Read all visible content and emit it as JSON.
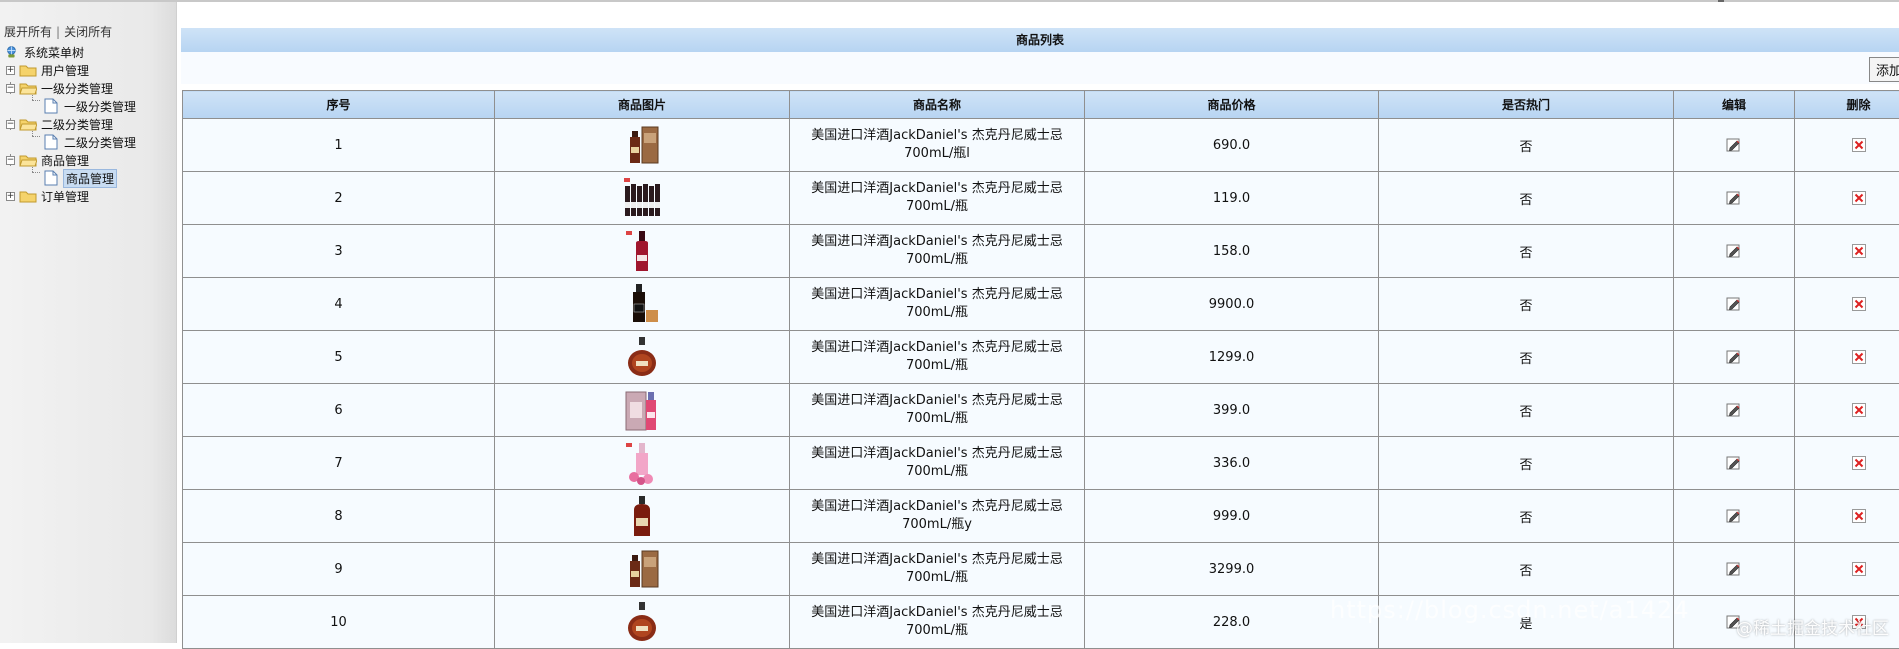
{
  "sidebar": {
    "expand_all": "展开所有",
    "separator": "|",
    "collapse_all": "关闭所有",
    "root_label": "系统菜单树",
    "groups": [
      {
        "label": "用户管理",
        "expanded": false,
        "child": ""
      },
      {
        "label": "一级分类管理",
        "expanded": true,
        "child": "一级分类管理"
      },
      {
        "label": "二级分类管理",
        "expanded": true,
        "child": "二级分类管理"
      },
      {
        "label": "商品管理",
        "expanded": true,
        "child": "商品管理"
      },
      {
        "label": "订单管理",
        "expanded": false,
        "child": ""
      }
    ]
  },
  "main": {
    "title": "商品列表",
    "add_button": "添加"
  },
  "table": {
    "headers": {
      "seq": "序号",
      "image": "商品图片",
      "name": "商品名称",
      "price": "商品价格",
      "hot": "是否热门",
      "edit": "编辑",
      "delete": "删除"
    },
    "rows": [
      {
        "seq": "1",
        "name": "美国进口洋酒JackDaniel's 杰克丹尼威士忌700mL/瓶l",
        "price": "690.0",
        "hot": "否",
        "thumb": "bottle-gift-box"
      },
      {
        "seq": "2",
        "name": "美国进口洋酒JackDaniel's 杰克丹尼威士忌700mL/瓶",
        "price": "119.0",
        "hot": "否",
        "thumb": "wine-six-pack"
      },
      {
        "seq": "3",
        "name": "美国进口洋酒JackDaniel's 杰克丹尼威士忌700mL/瓶",
        "price": "158.0",
        "hot": "否",
        "thumb": "red-wine-bottle"
      },
      {
        "seq": "4",
        "name": "美国进口洋酒JackDaniel's 杰克丹尼威士忌700mL/瓶",
        "price": "9900.0",
        "hot": "否",
        "thumb": "whisky-with-glass"
      },
      {
        "seq": "5",
        "name": "美国进口洋酒JackDaniel's 杰克丹尼威士忌700mL/瓶",
        "price": "1299.0",
        "hot": "否",
        "thumb": "cognac-decanter"
      },
      {
        "seq": "6",
        "name": "美国进口洋酒JackDaniel's 杰克丹尼威士忌700mL/瓶",
        "price": "399.0",
        "hot": "否",
        "thumb": "pink-gift-box"
      },
      {
        "seq": "7",
        "name": "美国进口洋酒JackDaniel's 杰克丹尼威士忌700mL/瓶",
        "price": "336.0",
        "hot": "否",
        "thumb": "pink-bottle-flowers"
      },
      {
        "seq": "8",
        "name": "美国进口洋酒JackDaniel's 杰克丹尼威士忌700mL/瓶y",
        "price": "999.0",
        "hot": "否",
        "thumb": "brandy-bottle"
      },
      {
        "seq": "9",
        "name": "美国进口洋酒JackDaniel's 杰克丹尼威士忌700mL/瓶",
        "price": "3299.0",
        "hot": "否",
        "thumb": "bottle-gift-box"
      },
      {
        "seq": "10",
        "name": "美国进口洋酒JackDaniel's 杰克丹尼威士忌700mL/瓶",
        "price": "228.0",
        "hot": "是",
        "thumb": "cognac-decanter"
      }
    ]
  },
  "watermark": {
    "text": "@稀土掘金技术社区"
  }
}
